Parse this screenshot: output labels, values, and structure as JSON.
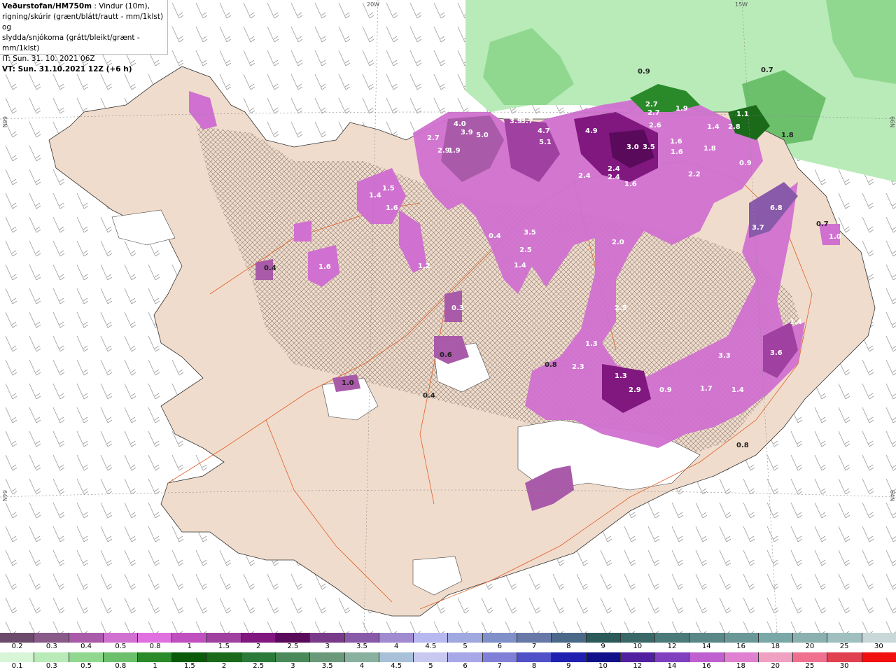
{
  "header": {
    "line1_bold": "Veðurstofan/HM750m",
    "line1_rest": " : Vindur (10m),",
    "line2": "rigning/skúrir (grænt/blátt/rautt - mm/1klst) og",
    "line3": "slydda/snjókoma (grátt/bleikt/grænt - mm/1klst)",
    "it_line": "IT: Sun. 31. 10. 2021 06Z",
    "vt_line": "VT: Sun. 31.10.2021 12Z (+6 h)"
  },
  "grid_labels": {
    "lon_20w": "20W",
    "lon_15w": "15W",
    "lat_66n_left": "66N",
    "lat_66n_right": "66N",
    "lat_64n_left": "64N",
    "lat_64n_right": "64N"
  },
  "map_values": [
    "2.7",
    "2.9",
    "1.9",
    "4.0",
    "3.9",
    "5.0",
    "3.9",
    "3.7",
    "4.7",
    "5.1",
    "4.9",
    "3.0",
    "3.5",
    "2.7",
    "2.7",
    "2.6",
    "1.9",
    "1.4",
    "2.8",
    "1.1",
    "2.4",
    "2.4",
    "2.4",
    "2.2",
    "1.8",
    "1.6",
    "1.6",
    "1.6",
    "0.9",
    "1.5",
    "1.6",
    "1.4",
    "1.6",
    "1.2",
    "0.4",
    "1.4",
    "2.5",
    "3.5",
    "2.0",
    "2.5",
    "1.3",
    "2.3",
    "1.3",
    "2.9",
    "0.9",
    "1.7",
    "1.4",
    "3.3",
    "3.6",
    "1.4",
    "6.8",
    "3.7",
    "1.0",
    "0.3",
    "0.6",
    "1.0",
    "0.4",
    "0.4",
    "0.8",
    "0.8",
    "0.7",
    "0.9",
    "0.7",
    "1.8"
  ],
  "legend_snow": {
    "colors": [
      "#6b4a6b",
      "#8a5a8a",
      "#a95aa9",
      "#d070d0",
      "#e070e0",
      "#c050c0",
      "#a040a0",
      "#801880",
      "#5a0a5a",
      "#7a3a8a",
      "#8a5aaa",
      "#a08ad0",
      "#b8b8f0",
      "#a0a8e0",
      "#8090c8",
      "#6878a8",
      "#4a6888",
      "#2a5a5a",
      "#3a6868",
      "#4a7a7a",
      "#5a8888",
      "#6a9898",
      "#7aa8a8",
      "#8ab0b0",
      "#a0c0c0",
      "#c8d8d8"
    ],
    "labels": [
      "0.2",
      "0.3",
      "0.4",
      "0.5",
      "0.8",
      "1",
      "1.5",
      "2",
      "2.5",
      "3",
      "3.5",
      "4",
      "4.5",
      "5",
      "6",
      "7",
      "8",
      "9",
      "10",
      "12",
      "14",
      "16",
      "18",
      "20",
      "25",
      "30"
    ]
  },
  "legend_rain": {
    "colors": [
      "#d8f5d8",
      "#b8ebb8",
      "#90d890",
      "#6cc06c",
      "#2a8a2a",
      "#0a5a0a",
      "#1a6a1a",
      "#2a7a3a",
      "#4a8a5a",
      "#6a9a7a",
      "#8ab0a0",
      "#a8c0d8",
      "#c8c8f0",
      "#a8a8e8",
      "#8080d8",
      "#5050c8",
      "#2020b0",
      "#10108a",
      "#5020a0",
      "#8040c0",
      "#c060d0",
      "#e080d0",
      "#f0a0c0",
      "#f07090",
      "#e04050",
      "#f01010"
    ],
    "labels": [
      "0.1",
      "0.3",
      "0.5",
      "0.8",
      "1",
      "1.5",
      "2",
      "2.5",
      "3",
      "3.5",
      "4",
      "4.5",
      "5",
      "6",
      "7",
      "8",
      "9",
      "10",
      "12",
      "14",
      "16",
      "18",
      "20",
      "25",
      "30"
    ]
  }
}
